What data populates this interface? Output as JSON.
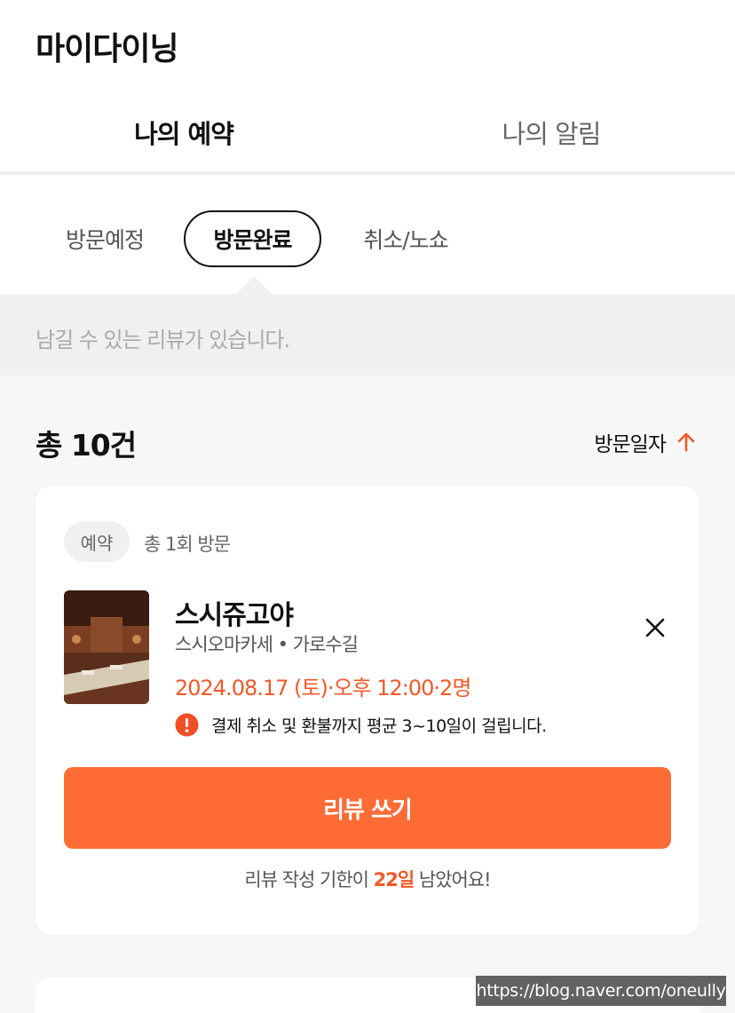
{
  "header": {
    "title": "마이다이닝"
  },
  "tabs": [
    {
      "label": "나의 예약",
      "active": true
    },
    {
      "label": "나의 알림",
      "active": false
    }
  ],
  "subtabs": [
    {
      "label": "방문예정",
      "active": false
    },
    {
      "label": "방문완료",
      "active": true
    },
    {
      "label": "취소/노쇼",
      "active": false
    }
  ],
  "notice": {
    "text": "남길 수 있는 리뷰가 있습니다."
  },
  "list": {
    "count_label": "총 10건",
    "sort_label": "방문일자",
    "sort_icon": "arrow-up-icon",
    "accent_color": "#f0592a"
  },
  "card": {
    "badge": "예약",
    "visit_count": "총 1회 방문",
    "restaurant_name": "스시쥬고야",
    "category": "스시오마카세",
    "separator": "•",
    "location": "가로수길",
    "datetime": "2024.08.17 (토)·오후 12:00·2명",
    "info_text": "결제 취소 및 환불까지 평균 3~10일이 걸립니다.",
    "info_icon": "exclamation-circle-icon",
    "close_icon": "close-icon",
    "review_button": "리뷰 쓰기",
    "review_button_color": "#fe6b35",
    "deadline_prefix": "리뷰 작성 기한이 ",
    "deadline_days": "22일",
    "deadline_suffix": " 남았어요!"
  },
  "watermark": "https://blog.naver.com/oneully"
}
